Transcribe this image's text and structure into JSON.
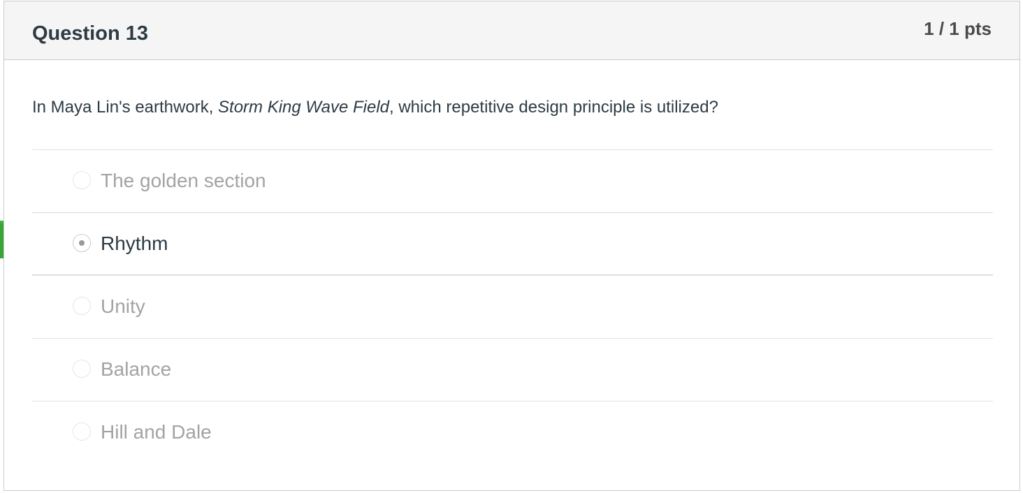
{
  "question": {
    "title": "Question 13",
    "points": "1 / 1 pts",
    "text_before": "In Maya Lin's earthwork, ",
    "text_italic": "Storm King Wave Field",
    "text_after": ", which repetitive design principle is utilized?"
  },
  "answers": [
    {
      "label": "The golden section",
      "selected": false
    },
    {
      "label": "Rhythm",
      "selected": true
    },
    {
      "label": "Unity",
      "selected": false
    },
    {
      "label": "Balance",
      "selected": false
    },
    {
      "label": "Hill and Dale",
      "selected": false
    }
  ],
  "colors": {
    "correct_marker": "#3aa535",
    "header_bg": "#f5f5f5",
    "unselected_text": "#a3a3a3",
    "selected_text": "#2d3b45"
  },
  "icons": {
    "correct_marker": "correct-answer-arrow-icon"
  }
}
